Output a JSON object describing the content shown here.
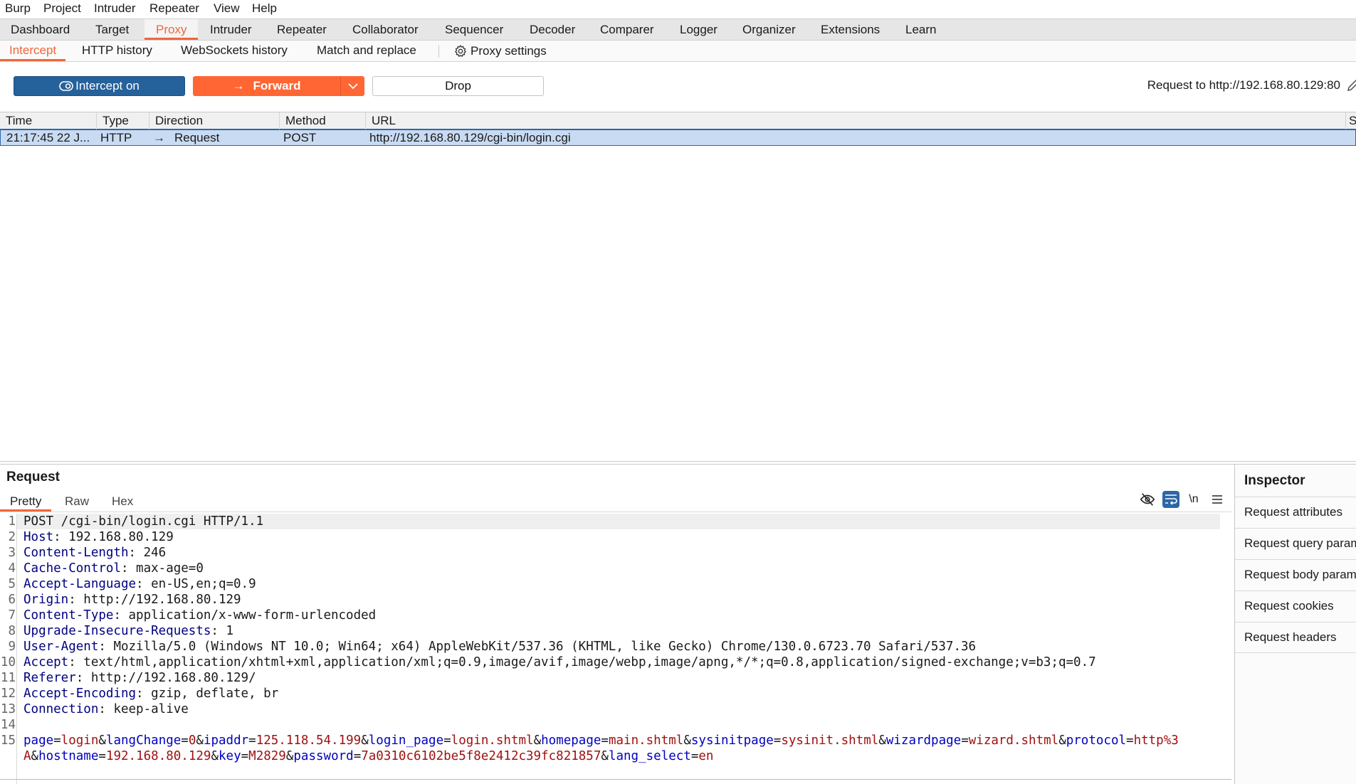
{
  "menu": [
    "Burp",
    "Project",
    "Intruder",
    "Repeater",
    "View",
    "Help"
  ],
  "tabs": [
    "Dashboard",
    "Target",
    "Proxy",
    "Intruder",
    "Repeater",
    "Collaborator",
    "Sequencer",
    "Decoder",
    "Comparer",
    "Logger",
    "Organizer",
    "Extensions",
    "Learn"
  ],
  "active_tab": "Proxy",
  "subtabs": [
    "Intercept",
    "HTTP history",
    "WebSockets history",
    "Match and replace"
  ],
  "proxy_settings": "Proxy settings",
  "buttons": {
    "intercept": "Intercept on",
    "forward": "Forward",
    "drop": "Drop"
  },
  "request_to": "Request to http://192.168.80.129:80",
  "table": {
    "columns": [
      "Time",
      "Type",
      "Direction",
      "Method",
      "URL",
      "S"
    ],
    "rows": [
      {
        "time": "21:17:45 22 J...",
        "type": "HTTP",
        "direction": "Request",
        "method": "POST",
        "url": "http://192.168.80.129/cgi-bin/login.cgi"
      }
    ]
  },
  "request": {
    "title": "Request",
    "tabs": [
      "Pretty",
      "Raw",
      "Hex"
    ],
    "request_line": "POST /cgi-bin/login.cgi HTTP/1.1",
    "headers": [
      {
        "name": "Host",
        "value": "192.168.80.129"
      },
      {
        "name": "Content-Length",
        "value": "246"
      },
      {
        "name": "Cache-Control",
        "value": "max-age=0"
      },
      {
        "name": "Accept-Language",
        "value": "en-US,en;q=0.9"
      },
      {
        "name": "Origin",
        "value": "http://192.168.80.129"
      },
      {
        "name": "Content-Type",
        "value": "application/x-www-form-urlencoded"
      },
      {
        "name": "Upgrade-Insecure-Requests",
        "value": "1"
      },
      {
        "name": "User-Agent",
        "value": "Mozilla/5.0 (Windows NT 10.0; Win64; x64) AppleWebKit/537.36 (KHTML, like Gecko) Chrome/130.0.6723.70 Safari/537.36"
      },
      {
        "name": "Accept",
        "value": "text/html,application/xhtml+xml,application/xml;q=0.9,image/avif,image/webp,image/apng,*/*;q=0.8,application/signed-exchange;v=b3;q=0.7"
      },
      {
        "name": "Referer",
        "value": "http://192.168.80.129/"
      },
      {
        "name": "Accept-Encoding",
        "value": "gzip, deflate, br"
      },
      {
        "name": "Connection",
        "value": "keep-alive"
      }
    ],
    "body_params": [
      {
        "name": "page",
        "value": "login"
      },
      {
        "name": "langChange",
        "value": "0"
      },
      {
        "name": "ipaddr",
        "value": "125.118.54.199"
      },
      {
        "name": "login_page",
        "value": "login.shtml"
      },
      {
        "name": "homepage",
        "value": "main.shtml"
      },
      {
        "name": "sysinitpage",
        "value": "sysinit.shtml"
      },
      {
        "name": "wizardpage",
        "value": "wizard.shtml"
      },
      {
        "name": "protocol",
        "value": "http%3A"
      },
      {
        "name": "hostname",
        "value": "192.168.80.129"
      },
      {
        "name": "key",
        "value": "M2829"
      },
      {
        "name": "password",
        "value": "7a0310c6102be5f8e2412c39fc821857"
      },
      {
        "name": "lang_select",
        "value": "en"
      }
    ],
    "newline_label": "\\n"
  },
  "inspector": {
    "title": "Inspector",
    "sections": [
      "Request attributes",
      "Request query parameters",
      "Request body parameters",
      "Request cookies",
      "Request headers"
    ]
  },
  "colors": {
    "accent": "#ff6633",
    "intercept": "#25619a",
    "selection": "#c9dbf2",
    "header_name": "#000080",
    "param_name": "#0000c0",
    "param_value": "#a01010"
  }
}
